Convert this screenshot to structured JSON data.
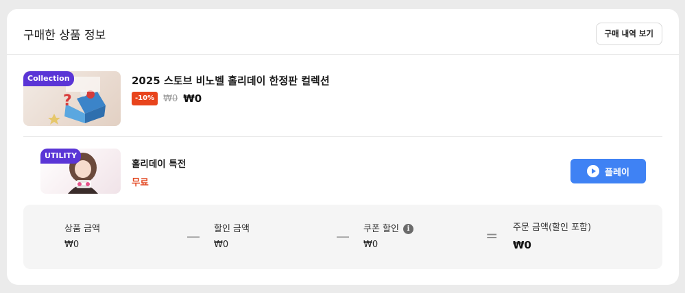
{
  "header": {
    "title": "구매한 상품 정보",
    "history_button": "구매 내역 보기"
  },
  "products": [
    {
      "badge": "Collection",
      "title": "2025 스토브 비노벨 홀리데이 한정판 컬렉션",
      "discount": "-10%",
      "original_price": "₩0",
      "final_price": "₩0"
    },
    {
      "badge": "UTILITY",
      "title": "홀리데이 특전",
      "price": "무료",
      "action_label": "플레이"
    }
  ],
  "summary": {
    "product_amount_label": "상품 금액",
    "product_amount_value": "₩0",
    "discount_amount_label": "할인 금액",
    "discount_amount_value": "₩0",
    "coupon_discount_label": "쿠폰 할인",
    "coupon_discount_value": "₩0",
    "order_amount_label": "주문 금액(할인 포함)",
    "order_amount_value": "₩0",
    "minus_symbol": "—",
    "equals_symbol": "="
  },
  "icons": {
    "info": "info-icon",
    "play": "play-icon"
  },
  "colors": {
    "accent": "#3f82f4",
    "badge": "#5a35d6",
    "discount": "#e8441c",
    "free_price": "#e34c26"
  }
}
